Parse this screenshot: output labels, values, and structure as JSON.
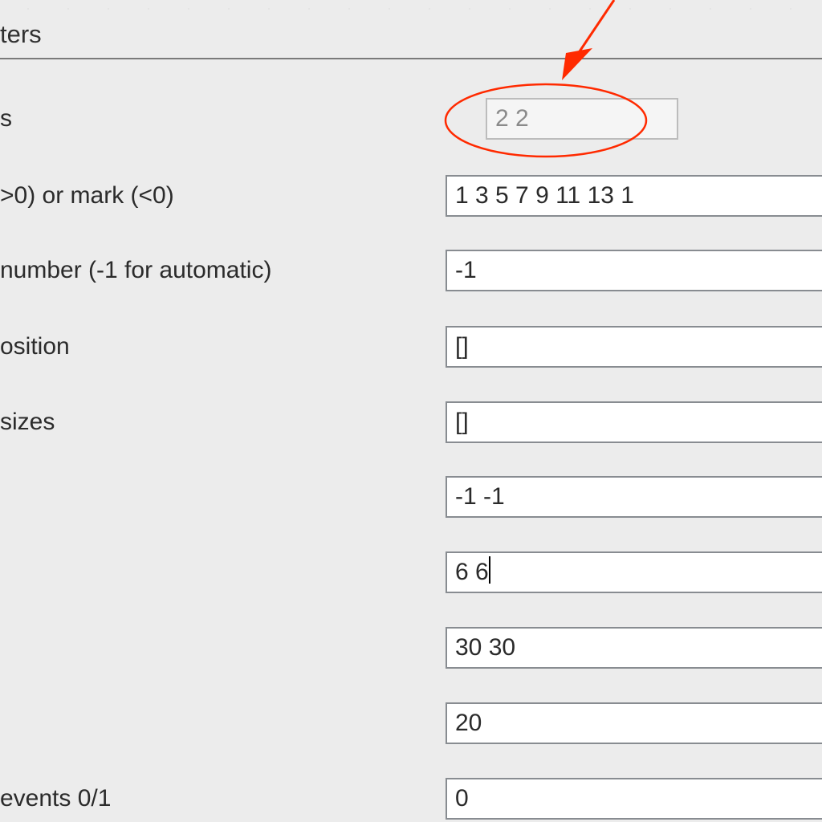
{
  "section": {
    "title_fragment": "ters"
  },
  "rows": {
    "r0": {
      "label_fragment": "s",
      "value": "2 2",
      "disabled": true
    },
    "r1": {
      "label_fragment": ">0) or mark (<0)",
      "value": "1 3 5 7 9 11 13 1"
    },
    "r2": {
      "label_fragment": "number (-1 for automatic)",
      "value": "-1"
    },
    "r3": {
      "label_fragment": "osition",
      "value": "[]"
    },
    "r4": {
      "label_fragment": "sizes",
      "value": "[]"
    },
    "r5": {
      "label_fragment": "",
      "value": "-1 -1"
    },
    "r6": {
      "label_fragment": "",
      "value": "6 6"
    },
    "r7": {
      "label_fragment": "",
      "value": "30 30"
    },
    "r8": {
      "label_fragment": "",
      "value": "20"
    },
    "r9": {
      "label_fragment": "events 0/1",
      "value": "0"
    }
  },
  "annotation": {
    "color": "#ff2a00"
  }
}
